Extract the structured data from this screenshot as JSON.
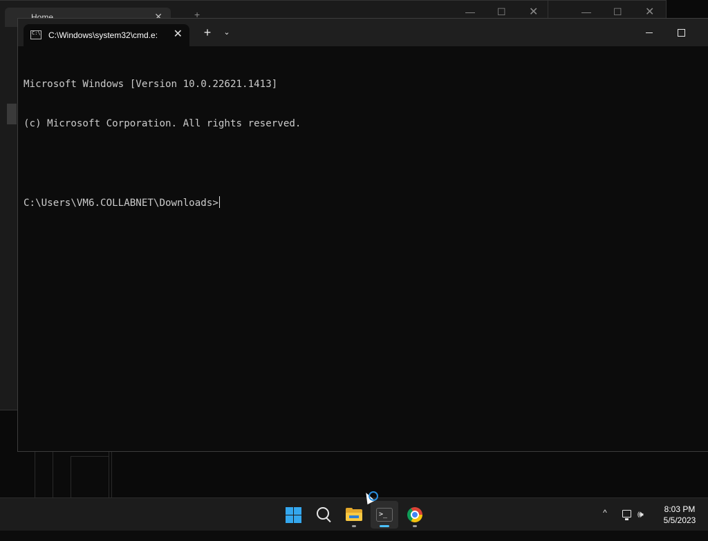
{
  "background_window": {
    "tab_title": "Home",
    "tab_close": "✕",
    "new_tab": "+"
  },
  "terminal": {
    "tab_title": "C:\\Windows\\system32\\cmd.e:",
    "tab_close": "✕",
    "new_tab_label": "+",
    "dropdown_label": "⌄",
    "console_lines": [
      "Microsoft Windows [Version 10.0.22621.1413]",
      "(c) Microsoft Corporation. All rights reserved.",
      "",
      "C:\\Users\\VM6.COLLABNET\\Downloads>"
    ]
  },
  "taskbar": {
    "apps": [
      "start-icon",
      "search-icon",
      "file-explorer-icon",
      "terminal-icon",
      "chrome-icon"
    ],
    "terminal_icon_glyph": ">_",
    "tray": {
      "overflow_chevron": "^",
      "volume_glyph": "🕪"
    },
    "clock": {
      "time": "8:03 PM",
      "date": "5/5/2023"
    }
  }
}
